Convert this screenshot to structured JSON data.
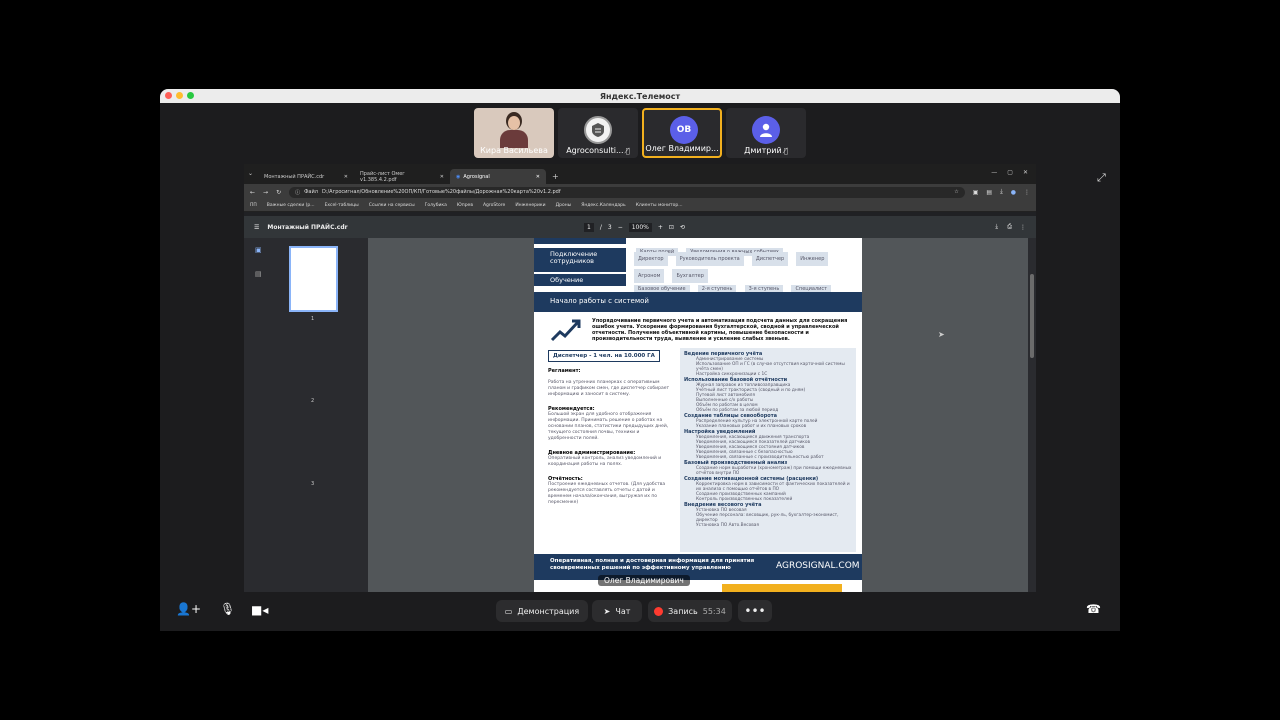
{
  "app": {
    "title": "Яндекс.Телемост"
  },
  "participants": [
    {
      "name": "Кира Васильева",
      "muted": false,
      "initials": ""
    },
    {
      "name": "Agroconsulti...",
      "muted": true,
      "initials": ""
    },
    {
      "name": "Олег Владимир...",
      "muted": false,
      "initials": "ОВ",
      "color": "#5b5fe8"
    },
    {
      "name": "Дмитрий",
      "muted": true,
      "initials": "",
      "color": "#5b5fe8"
    }
  ],
  "browser": {
    "tabs": [
      "Монтажный ПРАЙС.cdr",
      "Прайс-лист Омег v1.385.4.2.pdf",
      "Agrosignal"
    ],
    "url_prefix": "Файл",
    "url": "D:/Агросигнал/Обновление%20ОП/КП/Готовые%20файлы/Дорожная%20карта%20v1.2.pdf",
    "bookmarks": [
      "ПП",
      "Важные сделки (р...",
      "Excel-таблицы",
      "Ссылки на сервисы",
      "Голубика",
      "Юпрев",
      "AgroStore",
      "Инженерики",
      "Дроны",
      "Яндекс.Календарь",
      "Клиенты монитор..."
    ]
  },
  "pdf": {
    "filename": "Монтажный ПРАЙС.cdr",
    "page_current": "1",
    "page_total": "3",
    "zoom": "100%",
    "thumb_labels": [
      "1",
      "2",
      "3"
    ]
  },
  "doc": {
    "top_tags": [
      "Карты полей",
      "Уведомления о важных событиях"
    ],
    "rows": [
      {
        "label": "Подключение сотрудников",
        "tags": [
          "Директор",
          "Руководитель проекта",
          "Диспетчер",
          "Инженер",
          "Агроном",
          "Бухгалтер"
        ]
      },
      {
        "label": "Обучение",
        "tags": [
          "Базовое обучение",
          "2-я ступень",
          "3-я ступень",
          "Специалист"
        ]
      }
    ],
    "section_title": "Начало работы с системой",
    "intro": "Упорядочивание первичного учета и автоматизация подсчета данных для сокращения ошибок учета. Ускорение формирования бухгалтерской, сводной и управленческой отчетности. Получение объективной картины, повышение безопасности и производительности труда, выявление и усиление слабых звеньев.",
    "dispatcher": "Диспетчер - 1 чел. на 10.000 ГА",
    "left_blocks": [
      {
        "title": "Регламент:",
        "text": "Работа на утренних планерках с оперативным планом и графиком смен, где диспетчер собирает информацию и заносит в систему."
      },
      {
        "title": "Рекомендуется:",
        "text": "Большой экран для удобного отображения информации. Принимать решение о работах на основании планов, статистики предыдущих дней, текущего состояния почвы, техники и удобренности полей."
      },
      {
        "title": "Дневное администрирование:",
        "text": "Оперативный контроль, анализ уведомлений и координация работы на полях."
      },
      {
        "title": "Отчётность:",
        "text": "Построение ежедневных отчетов. (Для удобства рекомендуется составлять отчеты с датой и временем начала/окончания, выгружая их по пересменке)"
      }
    ],
    "right_sections": [
      {
        "title": "Ведение первичного учёта",
        "items": [
          "Администрирование системы",
          "Использование ОП и ГС (в случае отсутствия карточной системы учёта смен)",
          "Настройка синхронизации с 1С"
        ]
      },
      {
        "title": "Использование базовой отчётности",
        "items": [
          "Журнал заправок из топливозаправщика",
          "Учётный лист тракториста (сводный и по дням)",
          "Путевой лист автомобиля",
          "Выполненные с/х работы",
          "Объём по работам в целом",
          "Объём по работам за любой период"
        ]
      },
      {
        "title": "Создание таблицы севооборота",
        "items": [
          "Распределение культур на электронной карте полей",
          "Указание плановых работ и их плановых сроков"
        ]
      },
      {
        "title": "Настройка уведомлений",
        "items": [
          "Уведомления, касающиеся движения транспорта",
          "Уведомления, касающиеся показателей датчиков",
          "Уведомления, касающиеся состояния датчиков",
          "Уведомления, связанные с безопасностью",
          "Уведомления, связанные с производительностью работ"
        ]
      },
      {
        "title": "Базовый производственный анализ",
        "items": [
          "Создание норм выработки (хронометраж) при помощи ежедневных отчётов внутри ПО"
        ]
      },
      {
        "title": "Создание мотивационной системы (расценки)",
        "items": [
          "Корректировка норм в зависимости от фактических показателей и их анализа с помощью отчётов в ПО",
          "Создание производственных кампаний",
          "Контроль производственных показателей"
        ]
      },
      {
        "title": "Внедрение весового учёта",
        "items": [
          "Установка ПО весовая",
          "Обучение персонала: весовщик, рук-ль, бухгалтер-экономист, директор",
          "Установка ПО Авто.Весовая"
        ]
      }
    ],
    "footer_text": "Оперативная, полная и достоверная информация для принятия своевременных решений по эффективному управлению",
    "footer_brand": "AGROSIGNAL.COM",
    "presenter_caption": "Олег Владимирович"
  },
  "controls": {
    "demo": "Демонстрация",
    "chat": "Чат",
    "record": "Запись",
    "record_time": "55:34"
  },
  "colors": {
    "navy": "#1e3a5f",
    "accent": "#f2b01e",
    "record": "#ff3b30"
  }
}
